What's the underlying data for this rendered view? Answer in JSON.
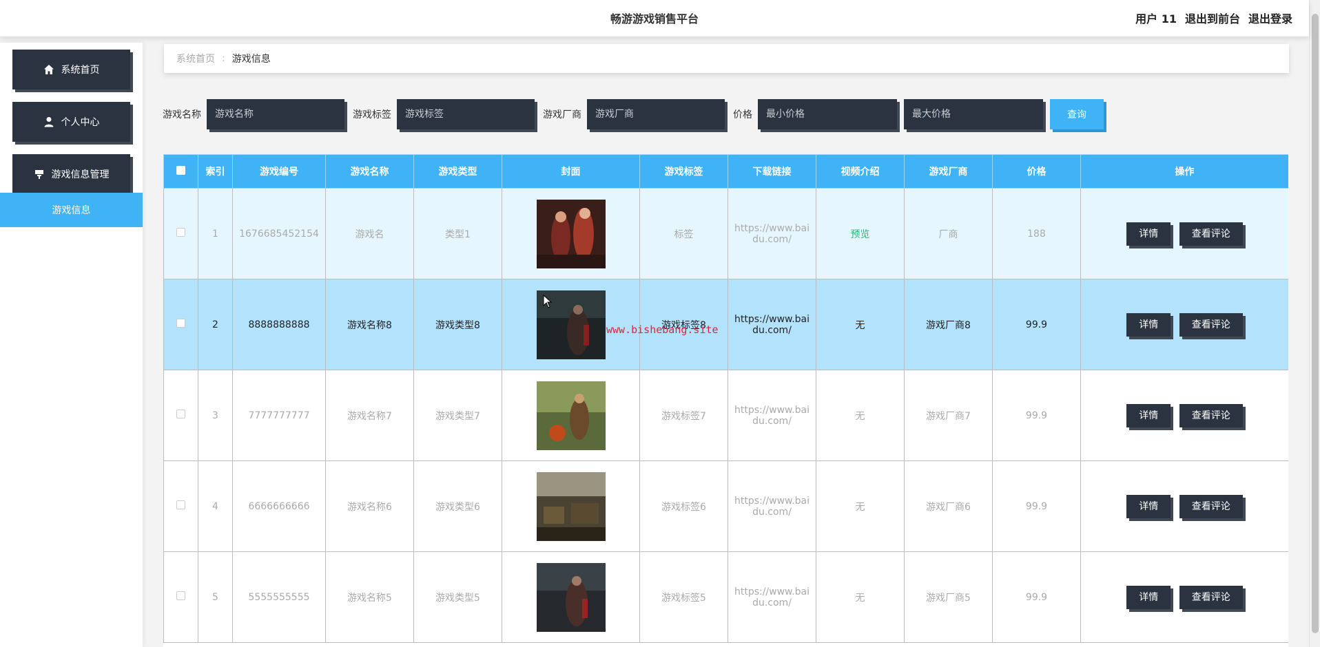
{
  "header": {
    "title": "畅游游戏销售平台",
    "user": "用户 11",
    "to_front": "退出到前台",
    "logout": "退出登录"
  },
  "sidebar": {
    "items": [
      {
        "label": "系统首页",
        "icon": "home-icon"
      },
      {
        "label": "个人中心",
        "icon": "user-icon"
      },
      {
        "label": "游戏信息管理",
        "icon": "manage-icon"
      }
    ],
    "sub_item": "游戏信息"
  },
  "breadcrumb": {
    "home": "系统首页",
    "current": "游戏信息"
  },
  "search": {
    "name_label": "游戏名称",
    "name_placeholder": "游戏名称",
    "tag_label": "游戏标签",
    "tag_placeholder": "游戏标签",
    "vendor_label": "游戏厂商",
    "vendor_placeholder": "游戏厂商",
    "price_label": "价格",
    "min_placeholder": "最小价格",
    "max_placeholder": "最大价格",
    "button": "查询"
  },
  "table": {
    "headers": [
      "索引",
      "游戏编号",
      "游戏名称",
      "游戏类型",
      "封面",
      "游戏标签",
      "下载链接",
      "视频介绍",
      "游戏厂商",
      "价格",
      "操作"
    ],
    "rows": [
      {
        "index": "1",
        "code": "1676685452154",
        "name": "游戏名",
        "type": "类型1",
        "tag": "标签",
        "link": "https://www.baidu.com/",
        "video": "预览",
        "vendor": "厂商",
        "price": "188"
      },
      {
        "index": "2",
        "code": "8888888888",
        "name": "游戏名称8",
        "type": "游戏类型8",
        "tag": "游戏标签8",
        "link": "https://www.baidu.com/",
        "video": "无",
        "vendor": "游戏厂商8",
        "price": "99.9"
      },
      {
        "index": "3",
        "code": "7777777777",
        "name": "游戏名称7",
        "type": "游戏类型7",
        "tag": "游戏标签7",
        "link": "https://www.baidu.com/",
        "video": "无",
        "vendor": "游戏厂商7",
        "price": "99.9"
      },
      {
        "index": "4",
        "code": "6666666666",
        "name": "游戏名称6",
        "type": "游戏类型6",
        "tag": "游戏标签6",
        "link": "https://www.baidu.com/",
        "video": "无",
        "vendor": "游戏厂商6",
        "price": "99.9"
      },
      {
        "index": "5",
        "code": "5555555555",
        "name": "游戏名称5",
        "type": "游戏类型5",
        "tag": "游戏标签5",
        "link": "https://www.baidu.com/",
        "video": "无",
        "vendor": "游戏厂商5",
        "price": "99.9"
      }
    ],
    "detail_label": "详情",
    "comment_label": "查看评论"
  },
  "watermark": "www.bishebang.site",
  "colors": {
    "accent": "#3fb3f5",
    "dark": "#2b3340",
    "preview_green": "#2bb673",
    "watermark_red": "#e0223d"
  }
}
